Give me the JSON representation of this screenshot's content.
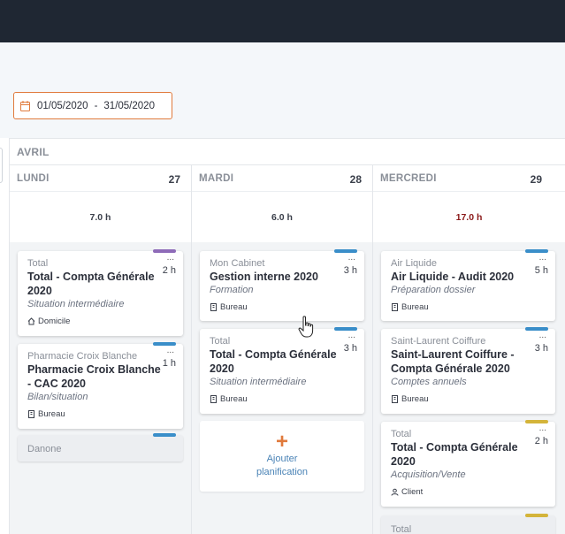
{
  "date_range": {
    "start": "01/05/2020",
    "separator": "-",
    "end": "31/05/2020"
  },
  "month": "AVRIL",
  "columns": [
    {
      "day": "LUNDI",
      "num": "27",
      "total": "7.0 h",
      "over": false,
      "cards": [
        {
          "client": "Total",
          "task": "Total - Compta Générale 2020",
          "sub": "Situation intermédiaire",
          "hours": "2 h",
          "location": "Domicile",
          "loc_icon": "home-icon",
          "tag_color": "#8e6bb8"
        },
        {
          "client": "Pharmacie Croix Blanche",
          "task": "Pharmacie Croix Blanche - CAC 2020",
          "sub": "Bilan/situation",
          "hours": "1 h",
          "location": "Bureau",
          "loc_icon": "building-icon",
          "tag_color": "#3a8ec9"
        },
        {
          "client": "Danone",
          "tag_color": "#3a8ec9"
        }
      ]
    },
    {
      "day": "MARDI",
      "num": "28",
      "total": "6.0 h",
      "over": false,
      "cards": [
        {
          "client": "Mon Cabinet",
          "task": "Gestion interne 2020",
          "sub": "Formation",
          "hours": "3 h",
          "location": "Bureau",
          "loc_icon": "building-icon",
          "tag_color": "#3a8ec9"
        },
        {
          "client": "Total",
          "task": "Total - Compta Générale 2020",
          "sub": "Situation intermédiaire",
          "hours": "3 h",
          "location": "Bureau",
          "loc_icon": "building-icon",
          "tag_color": "#3a8ec9"
        }
      ],
      "add": {
        "plus": "+",
        "label": "Ajouter planification"
      }
    },
    {
      "day": "MERCREDI",
      "num": "29",
      "total": "17.0 h",
      "over": true,
      "cards": [
        {
          "client": "Air Liquide",
          "task": "Air Liquide - Audit 2020",
          "sub": "Préparation dossier",
          "hours": "5 h",
          "location": "Bureau",
          "loc_icon": "building-icon",
          "tag_color": "#3a8ec9"
        },
        {
          "client": "Saint-Laurent Coiffure",
          "task": "Saint-Laurent Coiffure - Compta Générale 2020",
          "sub": "Comptes annuels",
          "hours": "3 h",
          "location": "Bureau",
          "loc_icon": "building-icon",
          "tag_color": "#3a8ec9"
        },
        {
          "client": "Total",
          "task": "Total - Compta Générale 2020",
          "sub": "Acquisition/Vente",
          "hours": "2 h",
          "location": "Client",
          "loc_icon": "user-icon",
          "tag_color": "#d4b43a"
        },
        {
          "client": "Total",
          "tag_color": "#d4b43a"
        }
      ]
    }
  ],
  "card_menu": "...",
  "colors": {
    "accent": "#e07a3c",
    "topbar": "#1f2733",
    "over_budget": "#8b1a1a",
    "link": "#4a83b6"
  }
}
